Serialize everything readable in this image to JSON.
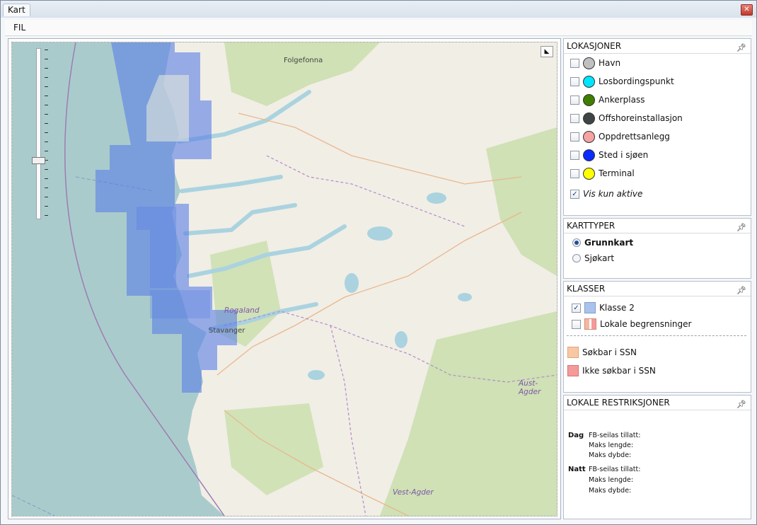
{
  "window": {
    "title": "Kart",
    "close_glyph": "✕"
  },
  "menu": {
    "fil": "FIL"
  },
  "map": {
    "labels": {
      "folgefonna": "Folgefonna",
      "rogaland": "Rogaland",
      "stavanger": "Stavanger",
      "aust_agder": "Aust-Agder",
      "vest_agder": "Vest-Agder"
    },
    "ctrl_glyph": "◣"
  },
  "lokasjoner": {
    "title": "LOKASJONER",
    "items": [
      {
        "label": "Havn",
        "color": "#c0c0c0",
        "checked": false
      },
      {
        "label": "Losbordingspunkt",
        "color": "#00e5ff",
        "checked": false
      },
      {
        "label": "Ankerplass",
        "color": "#3f7f00",
        "checked": false
      },
      {
        "label": "Offshoreinstallasjon",
        "color": "#3f4544",
        "checked": false
      },
      {
        "label": "Oppdrettsanlegg",
        "color": "#f6a3a3",
        "checked": false
      },
      {
        "label": "Sted i sjøen",
        "color": "#0a2bff",
        "checked": false
      },
      {
        "label": "Terminal",
        "color": "#ffff00",
        "checked": false
      }
    ],
    "vis_kun_aktive": {
      "label": "Vis kun aktive",
      "checked": true
    }
  },
  "karttyper": {
    "title": "KARTTYPER",
    "options": [
      {
        "label": "Grunnkart",
        "selected": true
      },
      {
        "label": "Sjøkart",
        "selected": false
      }
    ]
  },
  "klasser": {
    "title": "KLASSER",
    "items": [
      {
        "label": "Klasse 2",
        "checked": true,
        "color": "#aac3ea"
      },
      {
        "label": "Lokale begrensninger",
        "checked": false,
        "color": "#f4b89f"
      }
    ],
    "legend": [
      {
        "label": "Søkbar i SSN",
        "color": "#f8c8a4"
      },
      {
        "label": "Ikke søkbar i SSN",
        "color": "#f59a9a"
      }
    ]
  },
  "lokale_restriksjoner": {
    "title": "LOKALE RESTRIKSJONER",
    "dag": {
      "label": "Dag",
      "lines": [
        "FB-seilas tillatt:",
        "Maks lengde:",
        "Maks dybde:"
      ]
    },
    "natt": {
      "label": "Natt",
      "lines": [
        "FB-seilas tillatt:",
        "Maks lengde:",
        "Maks dybde:"
      ]
    }
  },
  "colors": {
    "sea": "#aacbcc",
    "land": "#f1eee6",
    "forest": "#c9deab",
    "lake": "#aad3df",
    "overlay": "#5a7fe6"
  },
  "icons": {
    "pin": "pin-icon",
    "close": "close-icon",
    "expand": "map-expand-icon"
  }
}
